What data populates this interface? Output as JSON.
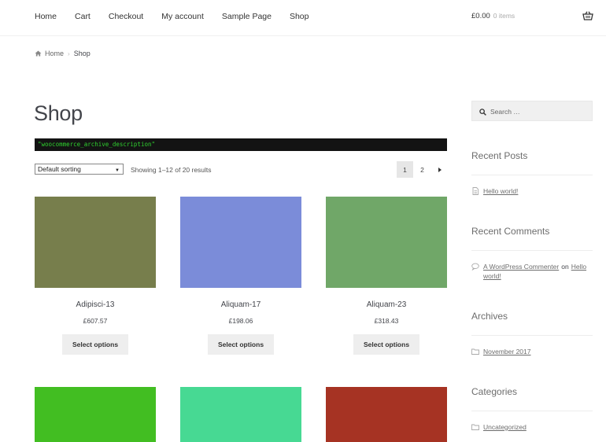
{
  "nav": {
    "items": [
      {
        "label": "Home"
      },
      {
        "label": "Cart"
      },
      {
        "label": "Checkout"
      },
      {
        "label": "My account"
      },
      {
        "label": "Sample Page"
      },
      {
        "label": "Shop"
      }
    ],
    "cart_amount": "£0.00",
    "cart_count": "0 items"
  },
  "breadcrumb": {
    "home": "Home",
    "current": "Shop"
  },
  "page": {
    "title": "Shop",
    "archive_description": "\"woocommerce_archive_description\""
  },
  "toolbar": {
    "sorting_selected": "Default sorting",
    "result_count": "Showing 1–12 of 20 results",
    "pages": [
      "1",
      "2"
    ]
  },
  "products": [
    {
      "name": "Adipisci-13",
      "price": "£607.57",
      "button": "Select options",
      "color": "#777e4c"
    },
    {
      "name": "Aliquam-17",
      "price": "£198.06",
      "button": "Select options",
      "color": "#7b8cd9"
    },
    {
      "name": "Aliquam-23",
      "price": "£318.43",
      "button": "Select options",
      "color": "#70a768"
    },
    {
      "name": "",
      "price": "",
      "button": "",
      "color": "#42be22"
    },
    {
      "name": "",
      "price": "",
      "button": "",
      "color": "#47d993"
    },
    {
      "name": "",
      "price": "",
      "button": "",
      "color": "#a63323"
    }
  ],
  "sidebar": {
    "search_placeholder": "Search …",
    "recent_posts_title": "Recent Posts",
    "recent_posts": [
      "Hello world!"
    ],
    "recent_comments_title": "Recent Comments",
    "comment": {
      "author": "A WordPress Commenter",
      "on": "on",
      "post": "Hello world!"
    },
    "archives_title": "Archives",
    "archives": [
      "November 2017"
    ],
    "categories_title": "Categories",
    "categories": [
      "Uncategorized"
    ]
  }
}
